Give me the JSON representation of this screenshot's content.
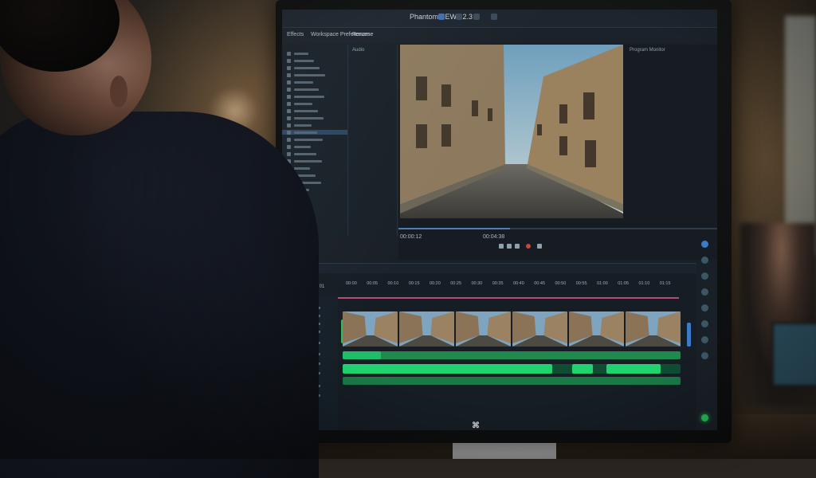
{
  "scene": {
    "description_tag": "person-editing-video-at-monitor"
  },
  "app": {
    "title": "PhantomVIEW 12.3",
    "topbar_icons": [
      "grid-icon",
      "layout-icon",
      "window-icon",
      "panel-icon"
    ],
    "menu": [
      {
        "label": "Effects"
      },
      {
        "label": "Workspace Preferences"
      },
      {
        "label": "Rename"
      }
    ],
    "mid_panel_label": "Audio",
    "program_label": "Program Monitor"
  },
  "project_tree": {
    "rows": 20,
    "selected_index": 11
  },
  "program": {
    "timecode_left": "00:00:12",
    "timecode_right": "00:04:38",
    "playback_progress": 0.35,
    "preview_subject": "cobblestone-street-between-old-buildings"
  },
  "timeline": {
    "sequence_label": "Sequence 01",
    "ruler_labels": [
      "00:00",
      "00:05",
      "00:10",
      "00:15",
      "00:20",
      "00:25",
      "00:30",
      "00:35",
      "00:40",
      "00:45",
      "00:50",
      "00:55",
      "01:00",
      "01:05",
      "01:10",
      "01:15"
    ],
    "video_thumbnails": 6,
    "audio_segments": [
      {
        "start": 0.0,
        "end": 0.62
      },
      {
        "start": 0.68,
        "end": 0.74
      },
      {
        "start": 0.78,
        "end": 0.94
      }
    ]
  },
  "colors": {
    "accent_blue": "#3a7cc8",
    "clip_green": "#21d36f",
    "playhead_pink": "#b44d72",
    "ui_background": "#1a2027"
  }
}
